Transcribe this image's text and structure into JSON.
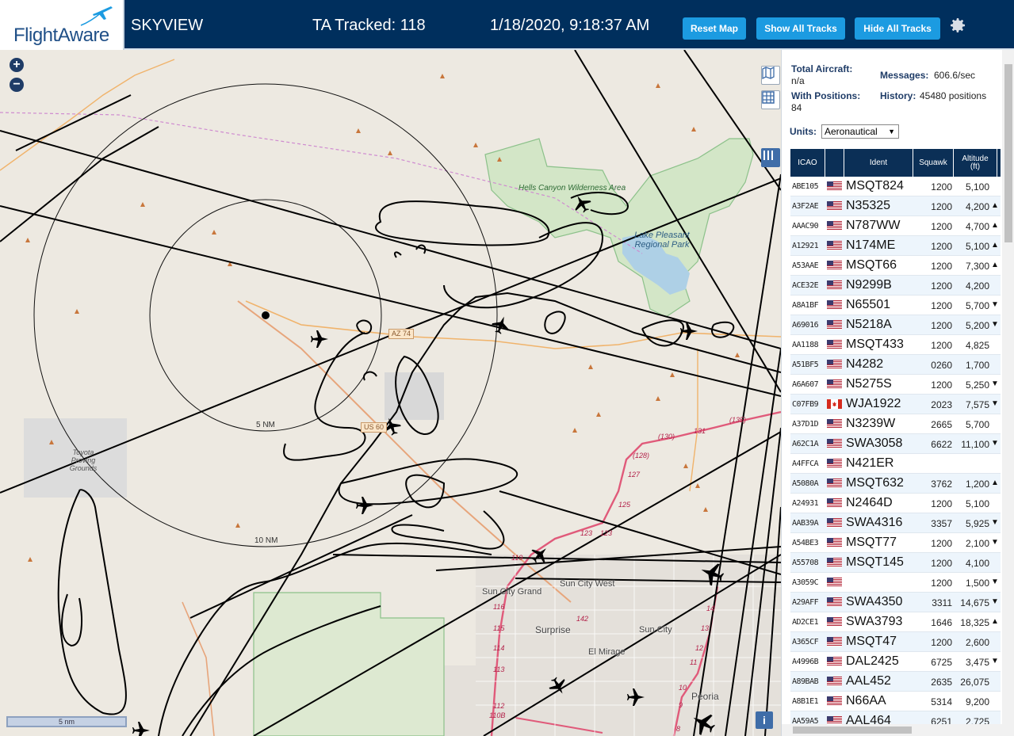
{
  "header": {
    "logo_text": "FlightAware",
    "title": "SKYVIEW",
    "tracked": "TA Tracked: 118",
    "datetime": "1/18/2020, 9:18:37 AM",
    "reset_map": "Reset Map",
    "show_all_tracks": "Show All Tracks",
    "hide_all_tracks": "Hide All Tracks",
    "settings_icon": "gear-icon"
  },
  "map": {
    "zoom_in": "+",
    "zoom_out": "−",
    "scale_label": "5 nm",
    "info": "i",
    "range_rings": [
      "5 NM",
      "10 NM"
    ],
    "labels": {
      "hells_canyon": "Hells Canyon Wilderness Area",
      "lake_pleasant": "Lake Pleasant Regional Park",
      "toyota": "Toyota Proving Grounds",
      "az74": "AZ 74",
      "us60": "US 60",
      "sun_city_grand": "Sun City Grand",
      "sun_city_west": "Sun City West",
      "surprise": "Surprise",
      "sun_city": "Sun City",
      "el_mirage": "El Mirage",
      "peoria": "Peoria"
    },
    "route_numbers": [
      "(135)",
      "(130)",
      "131",
      "(128)",
      "127",
      "125",
      "123",
      "123",
      "119",
      "116",
      "115",
      "114",
      "113",
      "112",
      "110B",
      "142",
      "14",
      "13",
      "12",
      "11",
      "10",
      "9",
      "8",
      "7"
    ],
    "accent_track_color": "#000000",
    "highway_color": "#e05a7a"
  },
  "panel": {
    "total_aircraft_label": "Total Aircraft:",
    "total_aircraft_value": "n/a",
    "messages_label": "Messages:",
    "messages_value": "606.6/sec",
    "with_positions_label": "With Positions:",
    "with_positions_value": "84",
    "history_label": "History:",
    "history_value": "45480 positions",
    "units_label": "Units:",
    "units_value": "Aeronautical",
    "columns": [
      "ICAO",
      "",
      "Ident",
      "Squawk",
      "Altitude (ft)"
    ],
    "rows": [
      {
        "icao": "ABE105",
        "flag": "us",
        "ident": "MSQT824",
        "squawk": "1200",
        "alt": "5,100",
        "trend": ""
      },
      {
        "icao": "A3F2AE",
        "flag": "us",
        "ident": "N35325",
        "squawk": "1200",
        "alt": "4,200",
        "trend": "▲"
      },
      {
        "icao": "AAAC90",
        "flag": "us",
        "ident": "N787WW",
        "squawk": "1200",
        "alt": "4,700",
        "trend": "▲"
      },
      {
        "icao": "A12921",
        "flag": "us",
        "ident": "N174ME",
        "squawk": "1200",
        "alt": "5,100",
        "trend": "▲"
      },
      {
        "icao": "A53AAE",
        "flag": "us",
        "ident": "MSQT66",
        "squawk": "1200",
        "alt": "7,300",
        "trend": "▲"
      },
      {
        "icao": "ACE32E",
        "flag": "us",
        "ident": "N9299B",
        "squawk": "1200",
        "alt": "4,200",
        "trend": ""
      },
      {
        "icao": "A8A1BF",
        "flag": "us",
        "ident": "N65501",
        "squawk": "1200",
        "alt": "5,700",
        "trend": "▼"
      },
      {
        "icao": "A69016",
        "flag": "us",
        "ident": "N5218A",
        "squawk": "1200",
        "alt": "5,200",
        "trend": "▼"
      },
      {
        "icao": "AA1188",
        "flag": "us",
        "ident": "MSQT433",
        "squawk": "1200",
        "alt": "4,825",
        "trend": ""
      },
      {
        "icao": "A51BF5",
        "flag": "us",
        "ident": "N4282",
        "squawk": "0260",
        "alt": "1,700",
        "trend": ""
      },
      {
        "icao": "A6A607",
        "flag": "us",
        "ident": "N5275S",
        "squawk": "1200",
        "alt": "5,250",
        "trend": "▼"
      },
      {
        "icao": "C07FB9",
        "flag": "ca",
        "ident": "WJA1922",
        "squawk": "2023",
        "alt": "7,575",
        "trend": "▼"
      },
      {
        "icao": "A37D1D",
        "flag": "us",
        "ident": "N3239W",
        "squawk": "2665",
        "alt": "5,700",
        "trend": ""
      },
      {
        "icao": "A62C1A",
        "flag": "us",
        "ident": "SWA3058",
        "squawk": "6622",
        "alt": "11,100",
        "trend": "▼"
      },
      {
        "icao": "A4FFCA",
        "flag": "us",
        "ident": "N421ER",
        "squawk": "",
        "alt": "",
        "trend": ""
      },
      {
        "icao": "A5080A",
        "flag": "us",
        "ident": "MSQT632",
        "squawk": "3762",
        "alt": "1,200",
        "trend": "▲"
      },
      {
        "icao": "A24931",
        "flag": "us",
        "ident": "N2464D",
        "squawk": "1200",
        "alt": "5,100",
        "trend": ""
      },
      {
        "icao": "AAB39A",
        "flag": "us",
        "ident": "SWA4316",
        "squawk": "3357",
        "alt": "5,925",
        "trend": "▼"
      },
      {
        "icao": "A54BE3",
        "flag": "us",
        "ident": "MSQT77",
        "squawk": "1200",
        "alt": "2,100",
        "trend": "▼"
      },
      {
        "icao": "A55708",
        "flag": "us",
        "ident": "MSQT145",
        "squawk": "1200",
        "alt": "4,100",
        "trend": ""
      },
      {
        "icao": "A3059C",
        "flag": "us",
        "ident": "",
        "squawk": "1200",
        "alt": "1,500",
        "trend": "▼"
      },
      {
        "icao": "A29AFF",
        "flag": "us",
        "ident": "SWA4350",
        "squawk": "3311",
        "alt": "14,675",
        "trend": "▼"
      },
      {
        "icao": "AD2CE1",
        "flag": "us",
        "ident": "SWA3793",
        "squawk": "1646",
        "alt": "18,325",
        "trend": "▲"
      },
      {
        "icao": "A365CF",
        "flag": "us",
        "ident": "MSQT47",
        "squawk": "1200",
        "alt": "2,600",
        "trend": ""
      },
      {
        "icao": "A4996B",
        "flag": "us",
        "ident": "DAL2425",
        "squawk": "6725",
        "alt": "3,475",
        "trend": "▼"
      },
      {
        "icao": "A89BAB",
        "flag": "us",
        "ident": "AAL452",
        "squawk": "2635",
        "alt": "26,075",
        "trend": ""
      },
      {
        "icao": "A8B1E1",
        "flag": "us",
        "ident": "N66AA",
        "squawk": "5314",
        "alt": "9,200",
        "trend": ""
      },
      {
        "icao": "AA59A5",
        "flag": "us",
        "ident": "AAL464",
        "squawk": "6251",
        "alt": "2,725",
        "trend": ""
      }
    ]
  }
}
